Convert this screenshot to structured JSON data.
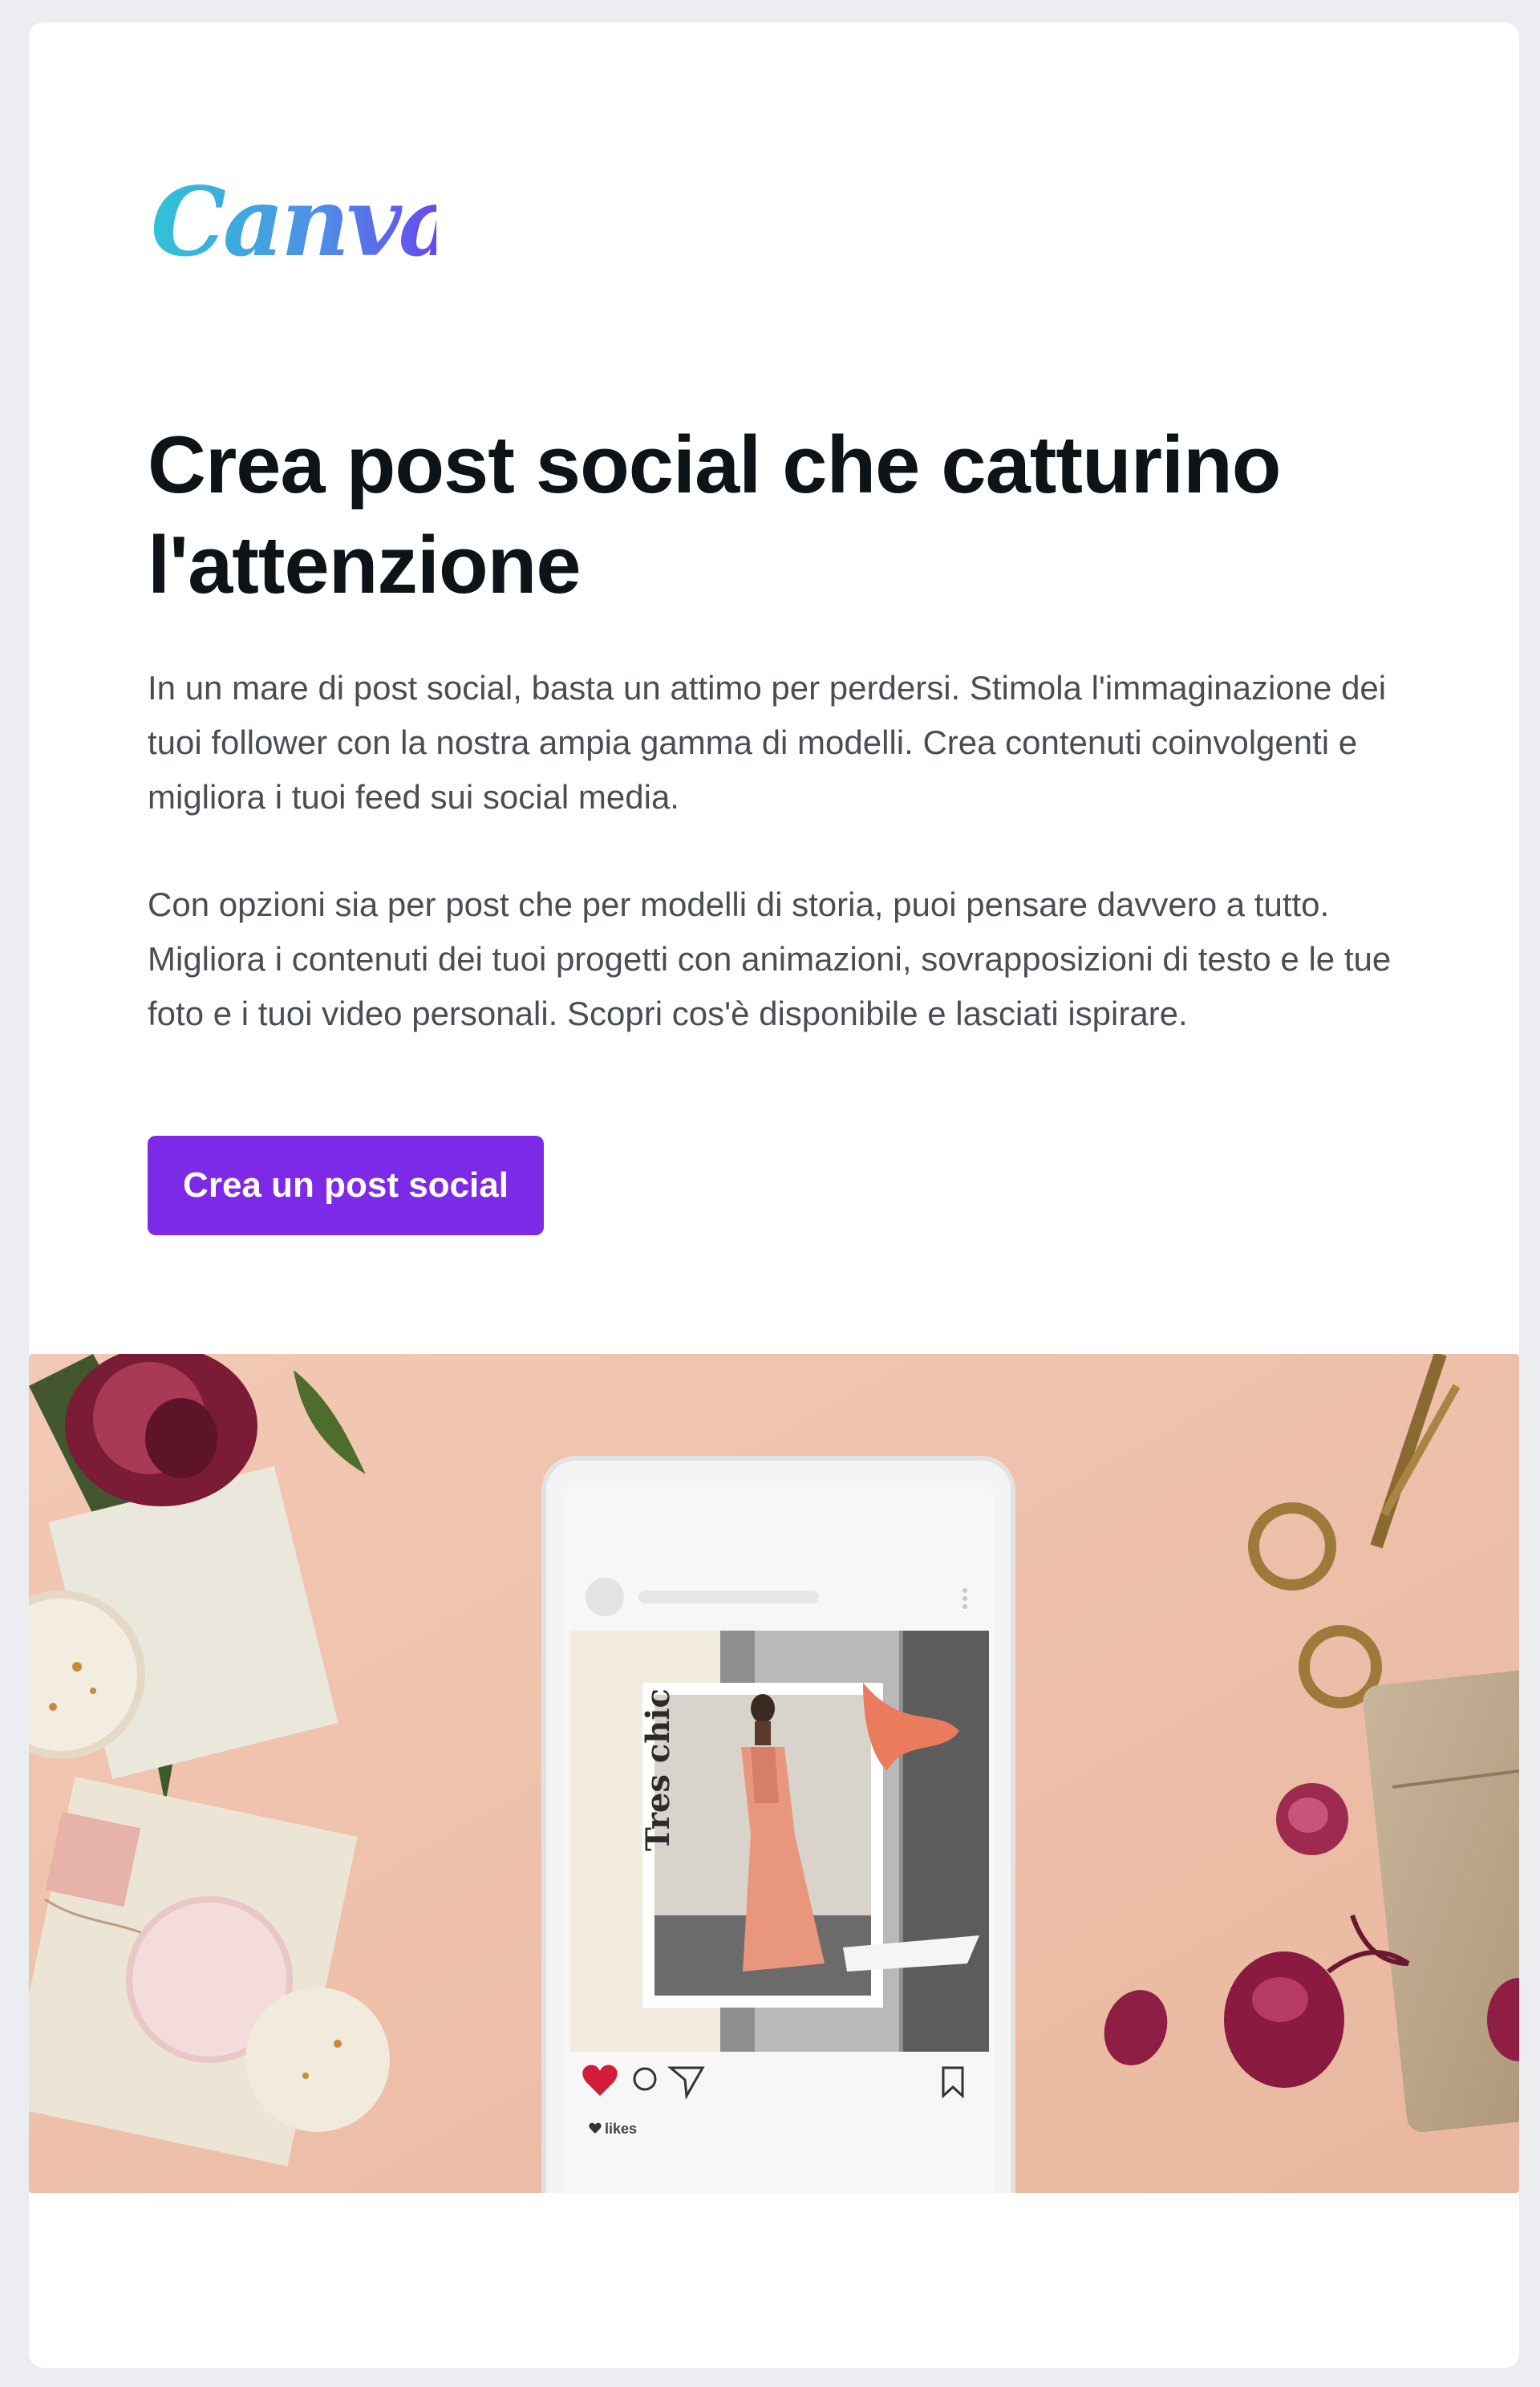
{
  "brand": {
    "logo_text": "Canva",
    "accent_color": "#7d2ae8",
    "logo_gradient": [
      "#2fc4d6",
      "#6a3df0"
    ]
  },
  "email": {
    "headline": "Crea post social che catturino l'attenzione",
    "paragraph_1": "In un mare di post social, basta un attimo per perdersi. Stimola l'immaginazione dei tuoi follower con la nostra ampia gamma di modelli. Crea contenuti coinvolgenti e migliora i tuoi feed sui social media.",
    "paragraph_2": "Con opzioni sia per post che per modelli di storia, puoi pensare davvero a tutto. Migliora i contenuti dei tuoi progetti con animazioni, sovrapposizioni di testo e le tue foto e i tuoi video personali. Scopri cos'è disponibile e lasciati ispirare.",
    "cta_label": "Crea un post social"
  },
  "hero": {
    "post_overlay_text": "Tres chic",
    "likes_label": "likes",
    "background_color": "#efc4ae"
  }
}
